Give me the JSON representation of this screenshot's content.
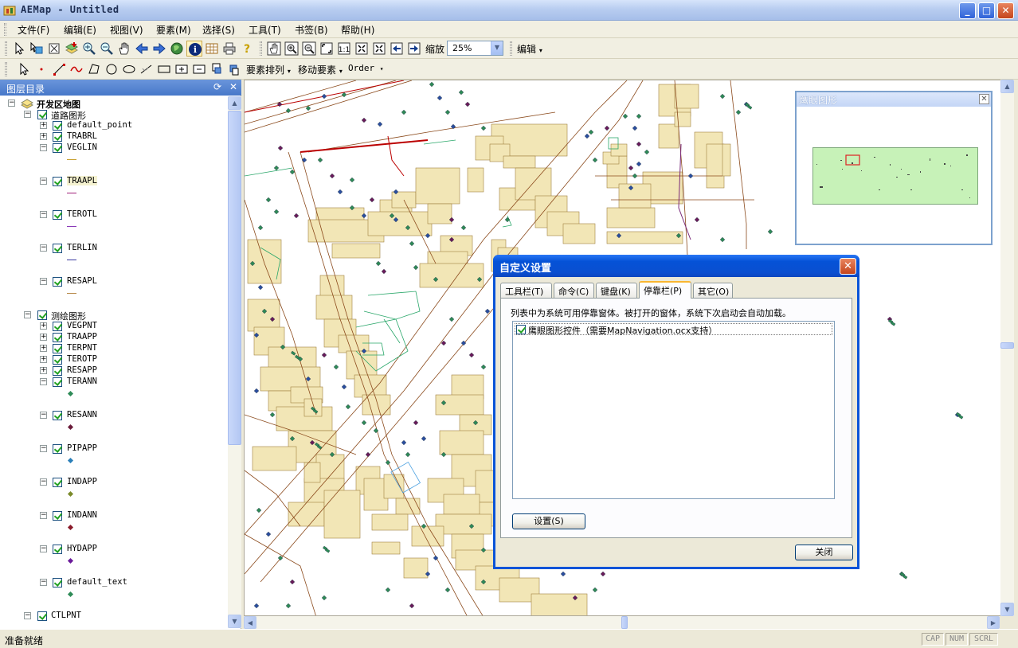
{
  "window": {
    "title": "AEMap - Untitled",
    "buttons": {
      "minimize": "_",
      "maximize": "□",
      "close": "✕"
    }
  },
  "menu": [
    "文件(F)",
    "编辑(E)",
    "视图(V)",
    "要素(M)",
    "选择(S)",
    "工具(T)",
    "书签(B)",
    "帮助(H)"
  ],
  "toolbar": {
    "zoom_label": "缩放",
    "zoom_value": "25%",
    "edit_label": "编辑",
    "arrange_label": "要素排列",
    "move_label": "移动要素",
    "order_label": "Order"
  },
  "toc": {
    "header": "图层目录",
    "map_name": "开发区地图",
    "group1": "道路图形",
    "group1_layers": [
      "default_point",
      "TRABRL",
      "VEGLIN",
      "TRAAPL",
      "TEROTL",
      "TERLIN",
      "RESAPL"
    ],
    "group2": "测绘图形",
    "group2_layers": [
      "VEGPNT",
      "TRAAPP",
      "TERPNT",
      "TEROTP",
      "RESAPP",
      "TERANN",
      "RESANN",
      "PIPAPP",
      "INDAPP",
      "INDANN",
      "HYDAPP",
      "default_text"
    ],
    "group3": "CTLPNT"
  },
  "overview": {
    "title": "鹰眼图形",
    "close": "✕"
  },
  "dialog": {
    "title": "自定义设置",
    "close": "✕",
    "tabs": [
      "工具栏(T)",
      "命令(C)",
      "键盘(K)",
      "停靠栏(P)",
      "其它(O)"
    ],
    "active_tab": 3,
    "description": "列表中为系统可用停靠窗体。被打开的窗体，系统下次启动会自动加载。",
    "list_items": [
      "鹰眼图形控件（需要MapNavigation.ocx支持）"
    ],
    "settings_button": "设置(S)",
    "close_button": "关闭"
  },
  "status": {
    "message": "准备就绪",
    "panes": [
      "CAP",
      "NUM",
      "SCRL"
    ]
  },
  "colors": {
    "building_fill": "#f2e6b6",
    "building_stroke": "#a08040",
    "road": "#8b4a1c",
    "green_line": "#2aa76a",
    "overview_fill": "#c7f2b8",
    "dialog_border": "#0a54d8"
  }
}
